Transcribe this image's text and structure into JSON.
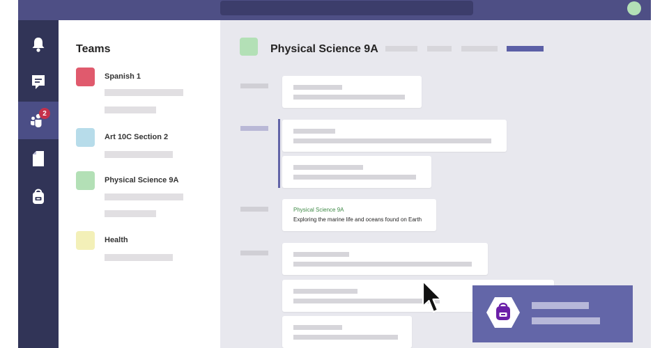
{
  "colors": {
    "topbar": "#4e4f85",
    "rail": "#313457",
    "rail_active": "#4b4e86",
    "accent": "#6264a7",
    "badge": "#c4314b",
    "notification": "#6366a8"
  },
  "rail": {
    "items": [
      {
        "icon": "bell-icon",
        "active": false
      },
      {
        "icon": "chat-icon",
        "active": false
      },
      {
        "icon": "teams-icon",
        "active": true,
        "badge": "2"
      },
      {
        "icon": "file-icon",
        "active": false
      },
      {
        "icon": "backpack-icon",
        "active": false
      }
    ]
  },
  "teams": {
    "heading": "Teams",
    "list": [
      {
        "name": "Spanish 1",
        "color": "#e05a6d"
      },
      {
        "name": "Art 10C Section 2",
        "color": "#b7dcea"
      },
      {
        "name": "Physical Science 9A",
        "color": "#b3e0b6"
      },
      {
        "name": "Health",
        "color": "#f3f0b8"
      }
    ]
  },
  "channel": {
    "title": "Physical Science 9A",
    "color": "#b3e0b6"
  },
  "message": {
    "title": "Physical Science 9A",
    "body": "Exploring the marine life and oceans found on Earth"
  },
  "notification": {
    "icon": "backpack-icon"
  }
}
